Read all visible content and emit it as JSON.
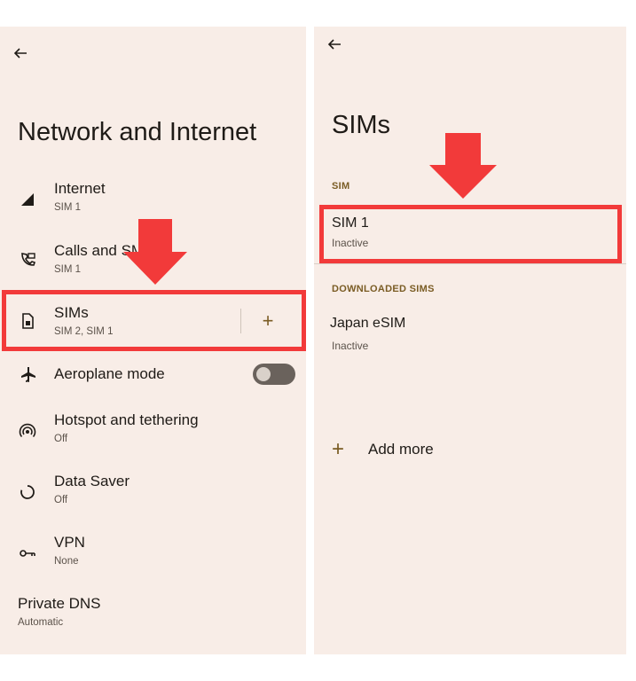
{
  "left_screen": {
    "title": "Network and Internet",
    "items": [
      {
        "label": "Internet",
        "sub": "SIM 1",
        "icon": "signal-icon"
      },
      {
        "label": "Calls and SMS",
        "sub": "SIM 1",
        "icon": "calls-sms-icon"
      },
      {
        "label": "SIMs",
        "sub": "SIM 2, SIM 1",
        "icon": "sim-card-icon"
      },
      {
        "label": "Aeroplane mode",
        "sub": "",
        "icon": "airplane-icon"
      },
      {
        "label": "Hotspot and tethering",
        "sub": "Off",
        "icon": "hotspot-icon"
      },
      {
        "label": "Data Saver",
        "sub": "Off",
        "icon": "data-saver-icon"
      },
      {
        "label": "VPN",
        "sub": "None",
        "icon": "vpn-key-icon"
      },
      {
        "label": "Private DNS",
        "sub": "Automatic",
        "icon": ""
      }
    ],
    "add_sim_symbol": "+",
    "aeroplane_mode_on": false
  },
  "right_screen": {
    "title": "SIMs",
    "section_sim": "SIM",
    "sim1": {
      "label": "SIM 1",
      "sub": "Inactive"
    },
    "section_downloaded": "DOWNLOADED SIMS",
    "esim": {
      "label": "Japan  eSIM",
      "sub": "Inactive"
    },
    "add_more": "Add more",
    "add_symbol": "+"
  },
  "colors": {
    "background": "#f8ede7",
    "accent": "#7a5c24",
    "highlight": "#f23a3a"
  }
}
